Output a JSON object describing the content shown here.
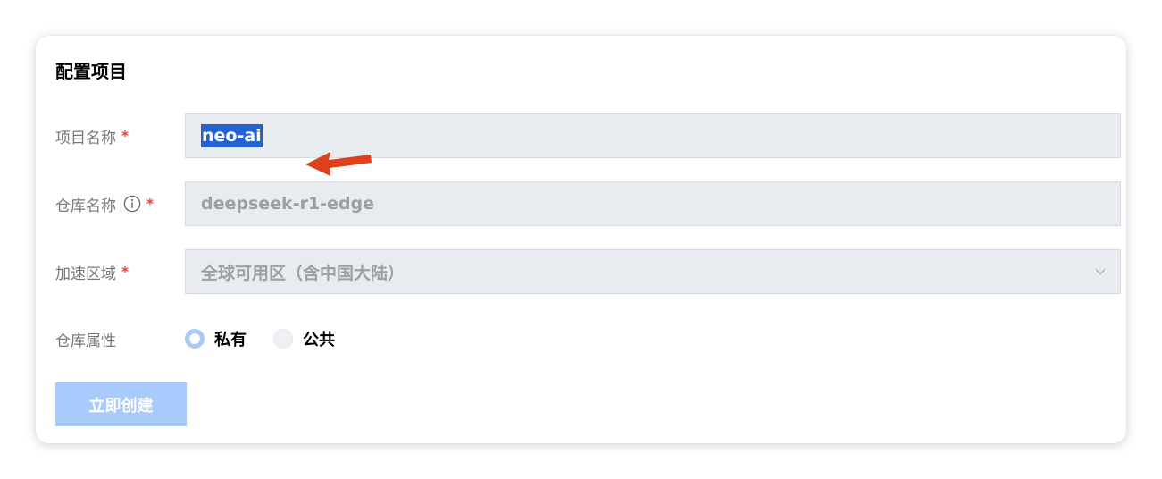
{
  "card": {
    "title": "配置项目"
  },
  "form": {
    "project_name": {
      "label": "项目名称",
      "required_mark": "*",
      "value": "neo-ai"
    },
    "repo_name": {
      "label": "仓库名称",
      "required_mark": "*",
      "info_icon": "info-circle-icon",
      "value": "deepseek-r1-edge"
    },
    "region": {
      "label": "加速区域",
      "required_mark": "*",
      "selected": "全球可用区（含中国大陆）",
      "caret_icon": "chevron-down-icon"
    },
    "repo_attr": {
      "label": "仓库属性",
      "options": [
        {
          "label": "私有",
          "checked": true
        },
        {
          "label": "公共",
          "checked": false
        }
      ]
    },
    "submit_label": "立即创建"
  },
  "annotation": {
    "arrow_icon": "red-arrow-icon",
    "arrow_color": "#e0401a"
  },
  "colors": {
    "required": "#e0413c",
    "selection": "#2360d1",
    "button": "#a9cbfb",
    "radio_checked": "#a9c9fb"
  }
}
